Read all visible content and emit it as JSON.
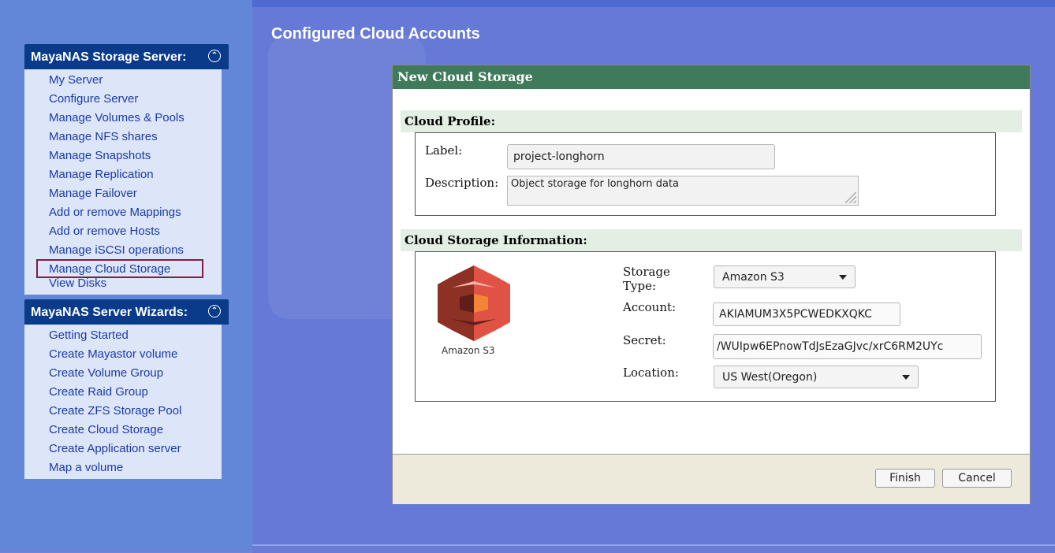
{
  "sidebar": {
    "server_panel": {
      "title": "MayaNAS Storage Server:",
      "items": [
        {
          "label": "My Server"
        },
        {
          "label": "Configure Server"
        },
        {
          "label": "Manage Volumes & Pools"
        },
        {
          "label": "Manage NFS shares"
        },
        {
          "label": "Manage Snapshots"
        },
        {
          "label": "Manage Replication"
        },
        {
          "label": "Manage Failover"
        },
        {
          "label": "Add or remove Mappings"
        },
        {
          "label": "Add or remove Hosts"
        },
        {
          "label": "Manage iSCSI operations"
        },
        {
          "label": "Manage Cloud Storage"
        },
        {
          "label": "View Disks"
        }
      ],
      "selected": "Manage Cloud Storage"
    },
    "wizards_panel": {
      "title": "MayaNAS Server Wizards:",
      "items": [
        {
          "label": "Getting Started"
        },
        {
          "label": "Create Mayastor volume"
        },
        {
          "label": "Create Volume Group"
        },
        {
          "label": "Create Raid Group"
        },
        {
          "label": "Create ZFS Storage Pool"
        },
        {
          "label": "Create Cloud Storage"
        },
        {
          "label": "Create Application server"
        },
        {
          "label": "Map a volume"
        }
      ]
    }
  },
  "main": {
    "title": "Configured Cloud Accounts"
  },
  "dialog": {
    "title": "New Cloud Storage",
    "profile": {
      "heading": "Cloud Profile:",
      "label_label": "Label:",
      "label_value": "project-longhorn",
      "description_label": "Description:",
      "description_value": "Object storage for longhorn data"
    },
    "storage": {
      "heading": "Cloud Storage Information:",
      "logo_caption": "Amazon S3",
      "type_label_line1": "Storage",
      "type_label_line2": "Type:",
      "type_value": "Amazon S3",
      "account_label": "Account:",
      "account_value": "AKIAMUM3X5PCWEDKXQKC",
      "secret_label": "Secret:",
      "secret_value": "/WUIpw6EPnowTdJsEzaGJvc/xrC6RM2UYc",
      "location_label": "Location:",
      "location_value": "US West(Oregon)"
    },
    "buttons": {
      "finish": "Finish",
      "cancel": "Cancel"
    }
  },
  "colors": {
    "sidebar_bg": "#6286d8",
    "panel_header": "#0a3a8a",
    "panel_body": "#dde6f8",
    "link": "#1a3aa8",
    "dialog_header": "#3f7a5a",
    "main_bg": "#6779d6",
    "s3_red": "#e05243"
  },
  "icons": {
    "collapse": "double-chevron-up-icon",
    "logo": "amazon-s3-logo"
  }
}
